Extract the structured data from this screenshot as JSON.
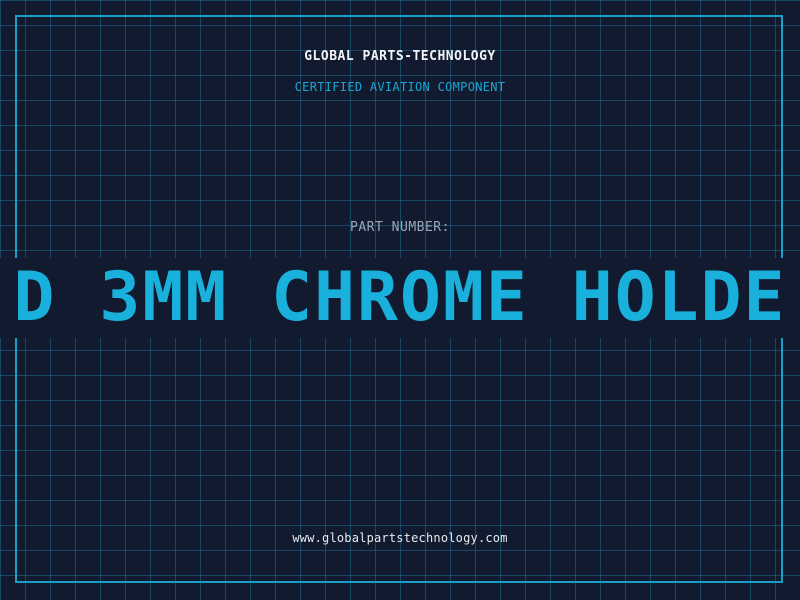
{
  "header": {
    "brand": "GLOBAL PARTS-TECHNOLOGY",
    "subtitle": "CERTIFIED AVIATION COMPONENT"
  },
  "part": {
    "label": "PART NUMBER:",
    "number": "D 3MM CHROME HOLDE"
  },
  "footer": {
    "website": "www.globalpartstechnology.com"
  },
  "colors": {
    "background": "#111a2e",
    "grid": "#1c6e8c",
    "frame": "#1a9fc8",
    "accent": "#19b0dc",
    "label": "#9aa6b6",
    "text": "#f2f4f8"
  }
}
